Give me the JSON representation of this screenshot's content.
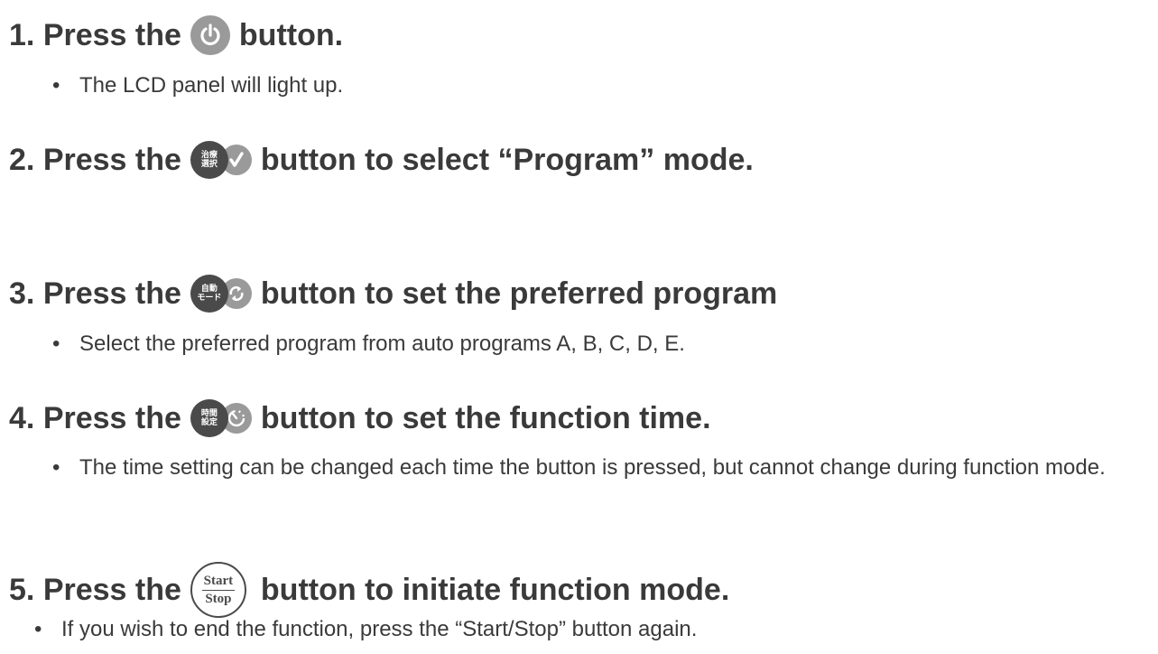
{
  "steps": [
    {
      "number": "1.",
      "lead": "Press the",
      "button_icon": "power-icon",
      "trail": "button.",
      "bullets": [
        "The LCD panel will light up."
      ]
    },
    {
      "number": "2.",
      "lead": "Press the",
      "button_icon": "treatment-select-check-icon",
      "button_jp": [
        "治療",
        "選択"
      ],
      "trail": "button to select “Program” mode.",
      "bullets": []
    },
    {
      "number": "3.",
      "lead": "Press the",
      "button_icon": "auto-mode-cycle-icon",
      "button_jp": [
        "自動",
        "モード"
      ],
      "trail": "button to set the preferred program",
      "bullets": [
        "Select the preferred program from auto programs A, B, C, D, E."
      ]
    },
    {
      "number": "4.",
      "lead": "Press the",
      "button_icon": "time-setting-timer-icon",
      "button_jp": [
        "時間",
        "設定"
      ],
      "trail": "button to set the function time.",
      "bullets": [
        "The time setting can be changed each time the button is pressed, but cannot change during function mode."
      ]
    },
    {
      "number": "5.",
      "lead": "Press the",
      "button_icon": "start-stop-icon",
      "button_text": [
        "Start",
        "Stop"
      ],
      "trail": "button to initiate function mode.",
      "bullets": [
        "If you wish to end the function, press the “Start/Stop” button again."
      ]
    }
  ],
  "bullet_symbol": "•",
  "colors": {
    "text": "#3a3a3a",
    "dark_button": "#4a4a4a",
    "grey_button": "#9a9a9a"
  }
}
